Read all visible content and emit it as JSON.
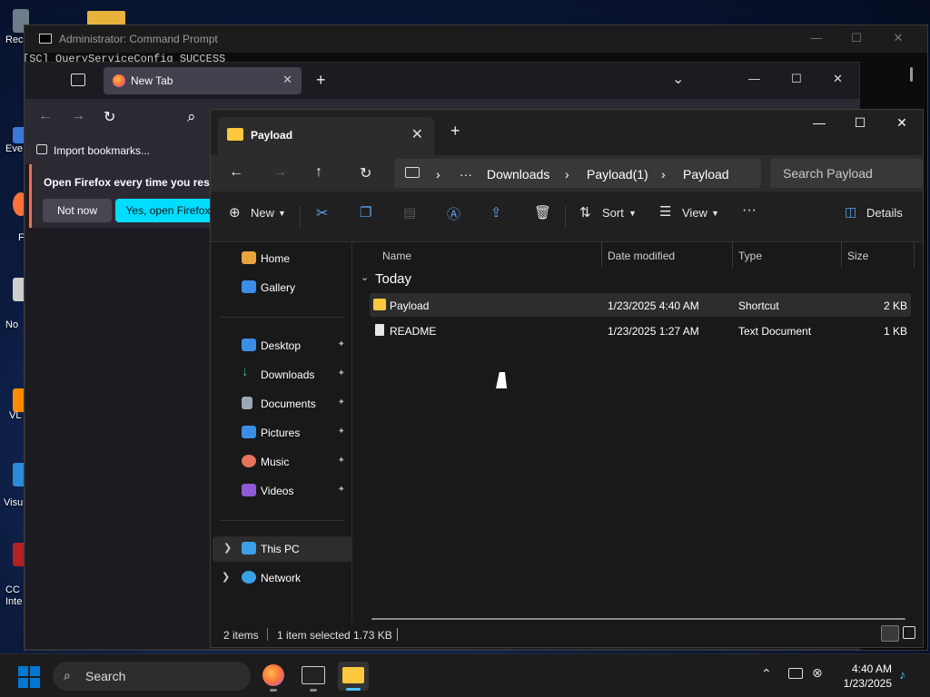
{
  "desktop": {
    "icons": [
      {
        "label": "Rec",
        "color": "#6f7d8a"
      },
      {
        "label": "Eve",
        "color": "#3b78d8"
      },
      {
        "label": "F",
        "color": "#ff7139"
      },
      {
        "label": "No",
        "color": "#cfcfcf"
      },
      {
        "label": "VL",
        "color": "#ff8c00"
      },
      {
        "label": "Visu",
        "color": "#2b8bd8"
      },
      {
        "label": "CC\nInte",
        "color": "#b22222"
      }
    ]
  },
  "cmd": {
    "title": "Administrator: Command Prompt",
    "console_line": "[SC] QueryServiceConfig SUCCESS",
    "min": "—",
    "max": "☐",
    "close": "✕"
  },
  "firefox": {
    "tab_title": "New Tab",
    "tab_close": "✕",
    "new_tab": "+",
    "list_all": "⌄",
    "min": "—",
    "max": "☐",
    "close": "✕",
    "back": "←",
    "forward": "→",
    "reload": "↻",
    "search_glyph": "⌕",
    "import_bookmarks": "Import bookmarks...",
    "notification": "Open Firefox every time you resta",
    "not_now": "Not now",
    "yes_open": "Yes, open Firefox",
    "accent": "#00ddff"
  },
  "explorer": {
    "tab_title": "Payload",
    "tab_close": "✕",
    "new_tab": "+",
    "min": "—",
    "max": "☐",
    "close": "✕",
    "breadcrumbs": [
      "Downloads",
      "Payload(1)",
      "Payload"
    ],
    "ellipsis": "···",
    "search_placeholder": "Search Payload",
    "toolbar": {
      "new": "New",
      "sort": "Sort",
      "view": "View",
      "more": "···",
      "details": "Details"
    },
    "sidebar": {
      "top": [
        {
          "label": "Home",
          "icon": "home-icon",
          "color": "#e8a33d"
        },
        {
          "label": "Gallery",
          "icon": "gallery-icon",
          "color": "#3a8ee6"
        }
      ],
      "pinned": [
        {
          "label": "Desktop",
          "icon": "desktop-icon",
          "color": "#3a8ee6"
        },
        {
          "label": "Downloads",
          "icon": "download-icon",
          "color": "#2ecc71"
        },
        {
          "label": "Documents",
          "icon": "documents-icon",
          "color": "#9aa7b5"
        },
        {
          "label": "Pictures",
          "icon": "pictures-icon",
          "color": "#3a8ee6"
        },
        {
          "label": "Music",
          "icon": "music-icon",
          "color": "#e6735c"
        },
        {
          "label": "Videos",
          "icon": "videos-icon",
          "color": "#8e5ad8"
        }
      ],
      "devices": [
        {
          "label": "This PC",
          "icon": "pc-icon",
          "color": "#3aa0e6"
        },
        {
          "label": "Network",
          "icon": "network-icon",
          "color": "#3aa0e6"
        }
      ],
      "pin_glyph": "📌",
      "chevron": "›"
    },
    "columns": [
      "Name",
      "Date modified",
      "Type",
      "Size"
    ],
    "group": "Today",
    "files": [
      {
        "name": "Payload",
        "date": "1/23/2025 4:40 AM",
        "type": "Shortcut",
        "size": "2 KB",
        "selected": true
      },
      {
        "name": "README",
        "date": "1/23/2025 1:27 AM",
        "type": "Text Document",
        "size": "1 KB",
        "selected": false
      }
    ],
    "status": {
      "count": "2 items",
      "selection": "1 item selected 1.73 KB"
    }
  },
  "taskbar": {
    "search": "Search",
    "time": "4:40 AM",
    "date": "1/23/2025",
    "accent": "#0078d4"
  }
}
